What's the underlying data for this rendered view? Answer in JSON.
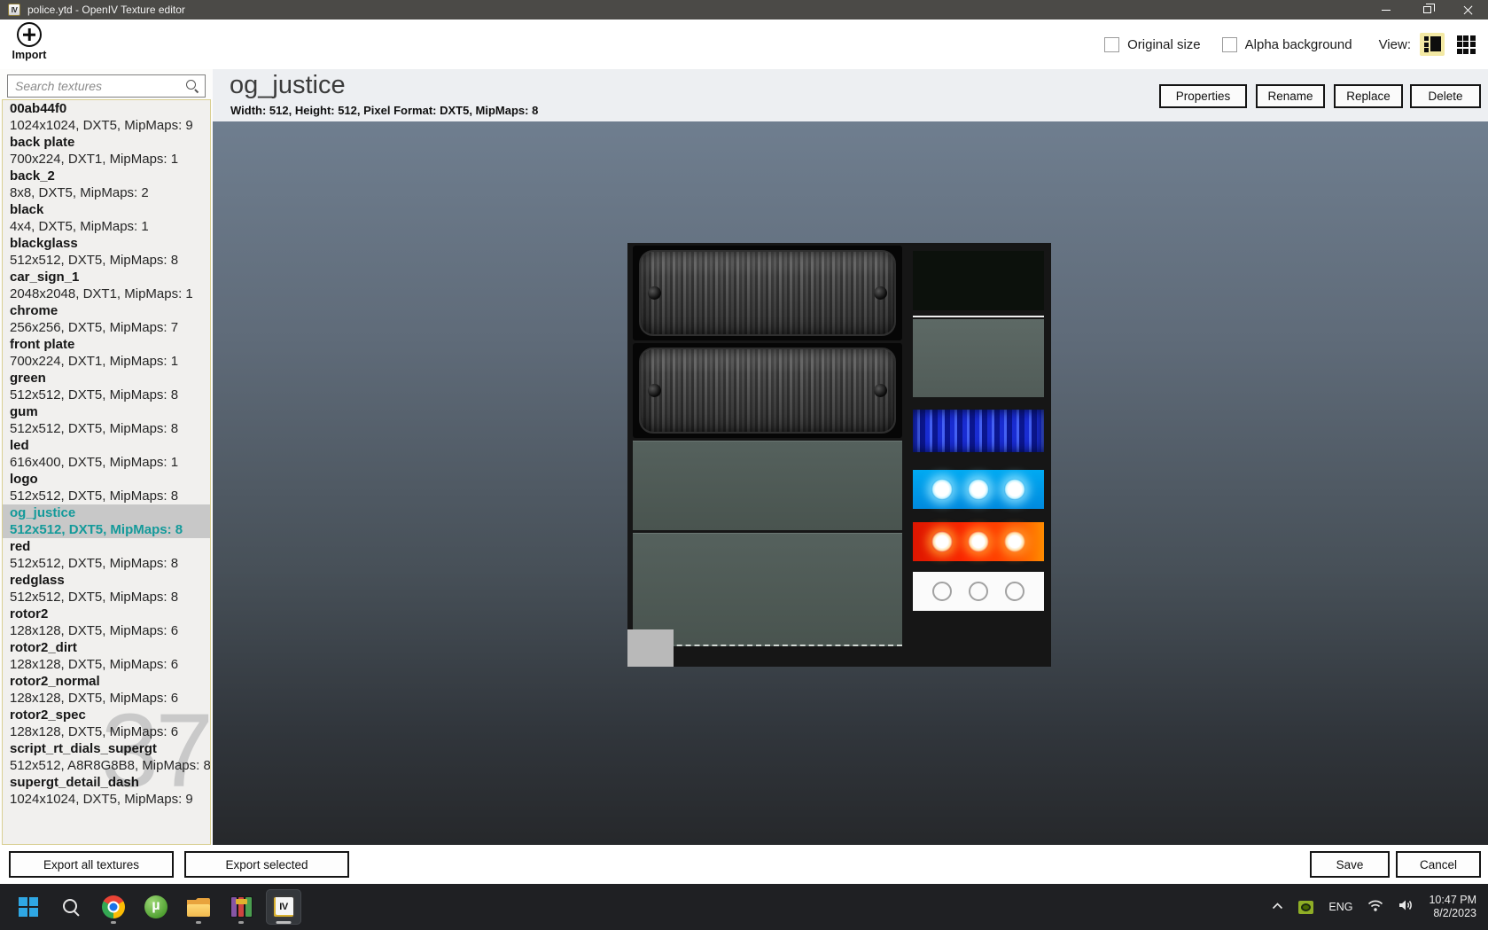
{
  "window": {
    "title": "police.ytd - OpenIV Texture editor"
  },
  "icons": {
    "openiv_logo_text": "IV"
  },
  "toolbar": {
    "import_label": "Import",
    "original_size_label": "Original size",
    "alpha_background_label": "Alpha background",
    "view_label": "View:"
  },
  "sidebar": {
    "search_placeholder": "Search textures",
    "count_watermark": "37",
    "items": [
      {
        "name": "00ab44f0",
        "details": "1024x1024, DXT5, MipMaps: 9",
        "selected": false
      },
      {
        "name": "back plate",
        "details": "700x224, DXT1, MipMaps: 1",
        "selected": false
      },
      {
        "name": "back_2",
        "details": "8x8, DXT5, MipMaps: 2",
        "selected": false
      },
      {
        "name": "black",
        "details": "4x4, DXT5, MipMaps: 1",
        "selected": false
      },
      {
        "name": "blackglass",
        "details": "512x512, DXT5, MipMaps: 8",
        "selected": false
      },
      {
        "name": "car_sign_1",
        "details": "2048x2048, DXT1, MipMaps: 1",
        "selected": false
      },
      {
        "name": "chrome",
        "details": "256x256, DXT5, MipMaps: 7",
        "selected": false
      },
      {
        "name": "front plate",
        "details": "700x224, DXT1, MipMaps: 1",
        "selected": false
      },
      {
        "name": "green",
        "details": "512x512, DXT5, MipMaps: 8",
        "selected": false
      },
      {
        "name": "gum",
        "details": "512x512, DXT5, MipMaps: 8",
        "selected": false
      },
      {
        "name": "led",
        "details": "616x400, DXT5, MipMaps: 1",
        "selected": false
      },
      {
        "name": "logo",
        "details": "512x512, DXT5, MipMaps: 8",
        "selected": false
      },
      {
        "name": "og_justice",
        "details": "512x512, DXT5, MipMaps: 8",
        "selected": true
      },
      {
        "name": "red",
        "details": "512x512, DXT5, MipMaps: 8",
        "selected": false
      },
      {
        "name": "redglass",
        "details": "512x512, DXT5, MipMaps: 8",
        "selected": false
      },
      {
        "name": "rotor2",
        "details": "128x128, DXT5, MipMaps: 6",
        "selected": false
      },
      {
        "name": "rotor2_dirt",
        "details": "128x128, DXT5, MipMaps: 6",
        "selected": false
      },
      {
        "name": "rotor2_normal",
        "details": "128x128, DXT5, MipMaps: 6",
        "selected": false
      },
      {
        "name": "rotor2_spec",
        "details": "128x128, DXT5, MipMaps: 6",
        "selected": false
      },
      {
        "name": "script_rt_dials_supergt",
        "details": "512x512, A8R8G8B8, MipMaps: 8",
        "selected": false
      },
      {
        "name": "supergt_detail_dash",
        "details": "1024x1024, DXT5, MipMaps: 9",
        "selected": false
      }
    ]
  },
  "header": {
    "title": "og_justice",
    "info": "Width: 512, Height: 512, Pixel Format: DXT5, MipMaps: 8",
    "buttons": {
      "properties": "Properties",
      "rename": "Rename",
      "replace": "Replace",
      "delete": "Delete"
    }
  },
  "footer": {
    "export_all": "Export all textures",
    "export_selected": "Export selected",
    "save": "Save",
    "cancel": "Cancel"
  },
  "taskbar": {
    "icons": [
      "start",
      "search",
      "chrome",
      "utorrent",
      "file-explorer",
      "winrar",
      "openiv"
    ],
    "tray": {
      "language": "ENG",
      "time": "10:47 PM",
      "date": "8/2/2023"
    }
  },
  "colors": {
    "accent_teal": "#149a9a",
    "selection_bg": "#c8c8c8",
    "view_highlight": "#f3e9a4",
    "titlebar": "#4b4a47",
    "preview_gradient_top": "#6f7e8f",
    "preview_gradient_bottom": "#26282b"
  }
}
